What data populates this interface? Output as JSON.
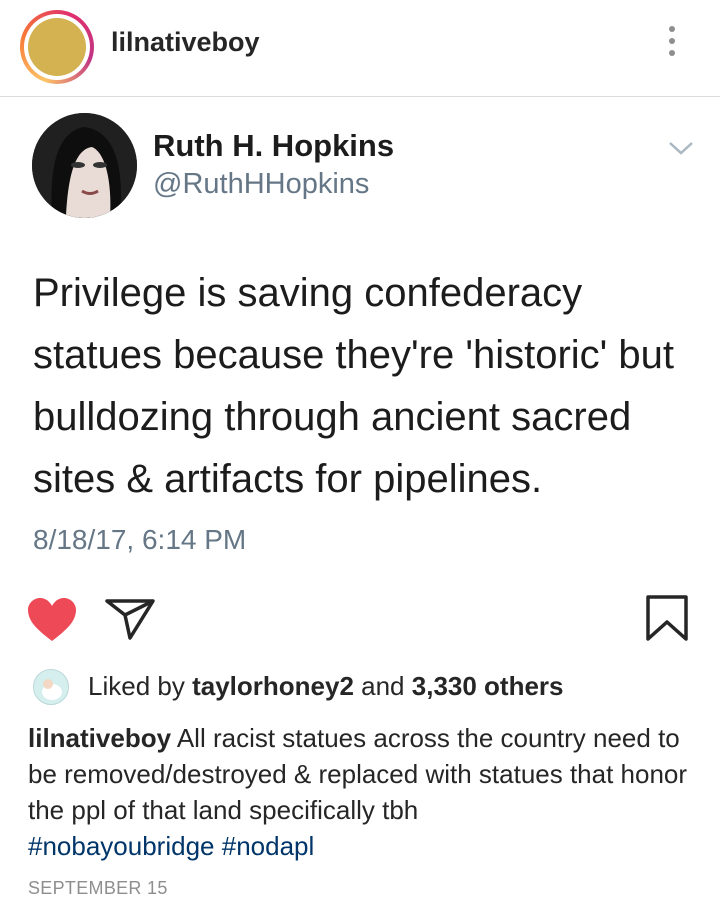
{
  "post": {
    "username": "lilnativeboy",
    "more_icon": "more-vertical-icon"
  },
  "tweet": {
    "name": "Ruth H. Hopkins",
    "handle": "@RuthHHopkins",
    "text": "Privilege is saving confederacy statues because they're 'historic' but bulldozing through ancient sacred sites & artifacts for pipelines.",
    "timestamp": "8/18/17, 6:14 PM"
  },
  "actions": {
    "like_icon": "heart-icon",
    "share_icon": "send-icon",
    "save_icon": "bookmark-icon",
    "like_color": "#ed4956"
  },
  "likes": {
    "prefix": "Liked by",
    "user": "taylorhoney2",
    "joiner": "and",
    "others": "3,330 others"
  },
  "caption": {
    "username": "lilnativeboy",
    "text": "All racist statues across the country need to be removed/destroyed & replaced with statues that honor the ppl of that land specifically tbh",
    "hashtags": [
      "#nobayoubridge",
      "#nodapl"
    ]
  },
  "date": "SEPTEMBER 15"
}
